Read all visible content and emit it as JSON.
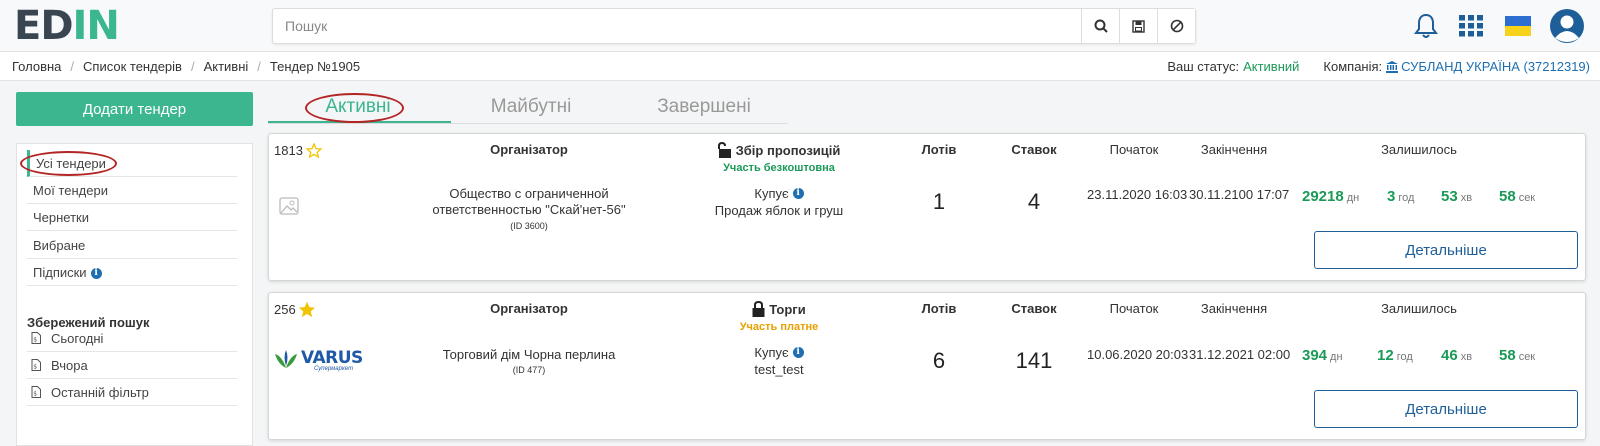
{
  "header": {
    "logo": "EDIN",
    "search_placeholder": "Пошук",
    "icons": [
      "search-icon",
      "save-icon",
      "clear-icon",
      "bell-icon",
      "apps-grid-icon",
      "ukraine-flag-icon",
      "user-avatar-icon"
    ]
  },
  "breadcrumb": [
    "Головна",
    "Список тендерів",
    "Активні",
    "Тендер №1905"
  ],
  "status": {
    "status_label": "Ваш статус:",
    "status_value": "Активний",
    "company_label": "Компанія:",
    "company_value": "СУБЛАНД УКРАЇНА (37212319)"
  },
  "sidebar": {
    "add_button": "Додати тендер",
    "items": [
      "Усі тендери",
      "Мої тендери",
      "Чернетки",
      "Вибране",
      "Підписки"
    ],
    "saved_title": "Збережений пошук",
    "saved_items": [
      "Сьогодні",
      "Вчора",
      "Останній фільтр"
    ]
  },
  "tabs": [
    "Активні",
    "Майбутні",
    "Завершені"
  ],
  "columns": {
    "organizer": "Організатор",
    "lots": "Лотів",
    "bids": "Ставок",
    "start": "Початок",
    "end": "Закінчення",
    "remaining": "Залишилось"
  },
  "tenders": [
    {
      "id": "1813",
      "stage": "Збір пропозицій",
      "participation": "Участь безкоштовна",
      "org_name": "Общество с ограниченной ответственностью \"Скай'нет-56\"",
      "org_id": "(ID 3600)",
      "buys_label": "Купує",
      "subject": "Продаж яблок и груш",
      "lots": "1",
      "bids": "4",
      "start": "23.11.2020 16:03",
      "end": "30.11.2100 17:07",
      "days": "29218",
      "days_unit": "дн",
      "hours": "3",
      "hours_unit": "год",
      "minutes": "53",
      "minutes_unit": "хв",
      "seconds": "58",
      "seconds_unit": "сек",
      "button": "Детальніше"
    },
    {
      "id": "256",
      "stage": "Торги",
      "participation": "Участь платне",
      "org_logo": "VARUS",
      "org_logo_sub": "Супермаркет",
      "org_name": "Торговий дім Чорна перлина",
      "org_id": "(ID 477)",
      "buys_label": "Купує",
      "subject": "test_test",
      "lots": "6",
      "bids": "141",
      "start": "10.06.2020 20:03",
      "end": "31.12.2021 02:00",
      "days": "394",
      "days_unit": "дн",
      "hours": "12",
      "hours_unit": "год",
      "minutes": "46",
      "minutes_unit": "хв",
      "seconds": "58",
      "seconds_unit": "сек",
      "button": "Детальніше"
    }
  ],
  "colors": {
    "brand_green": "#3bb68e",
    "link_blue": "#1f6fb0",
    "countdown_green": "#1b9a57",
    "free_green": "#1b9a57",
    "paid_orange": "#e6a100",
    "annotation_red": "#b32525"
  }
}
